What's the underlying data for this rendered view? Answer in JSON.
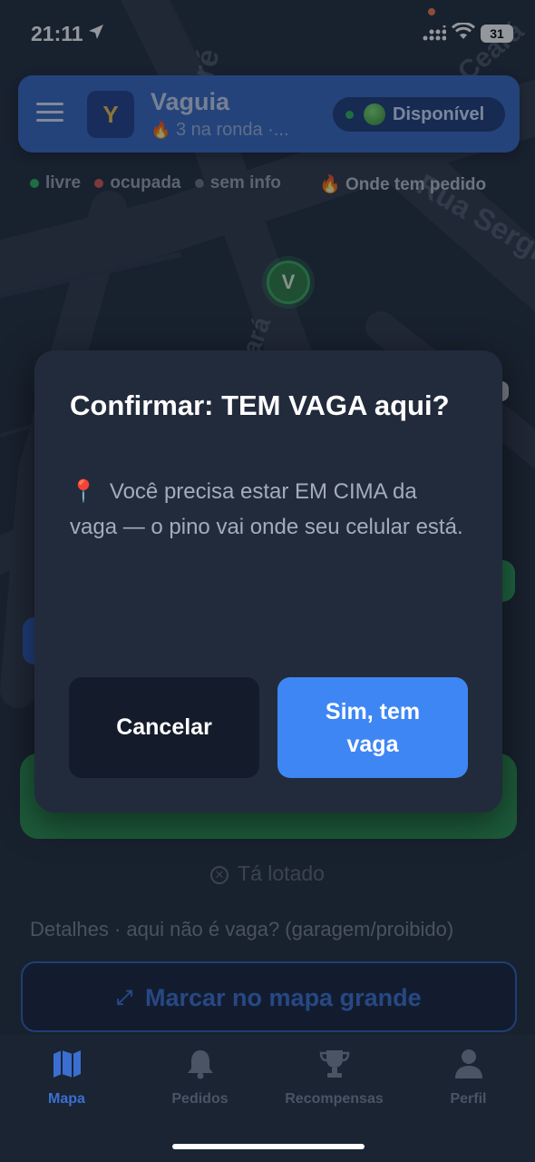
{
  "status_bar": {
    "time": "21:11",
    "battery": "31"
  },
  "map": {
    "street_labels": [
      "aré",
      "Rua Sergipe",
      "Ceará",
      "ará"
    ],
    "marker_v_label": "V"
  },
  "header": {
    "logo_letter": "Y",
    "title": "Vaguia",
    "subtitle_icon": "🔥",
    "subtitle": "3 na ronda ·...",
    "status_label": "Disponível",
    "status_color": "#2bb25d"
  },
  "legend": {
    "items": [
      {
        "label": "livre",
        "color": "#2bb25d"
      },
      {
        "label": "ocupada",
        "color": "#d9534f"
      },
      {
        "label": "sem info",
        "color": "#6b7486"
      }
    ],
    "orders_icon": "🔥",
    "orders_label": "Onde tem pedido"
  },
  "modal": {
    "title": "Confirmar: TEM VAGA aqui?",
    "body_icon": "📍",
    "body": "Você precisa estar EM CIMA da vaga — o pino vai onde seu celular está.",
    "cancel_label": "Cancelar",
    "confirm_label": "Sim, tem vaga",
    "confirm_color": "#3f86f5"
  },
  "behind": {
    "lotado_label": "Tá lotado",
    "details_text": "Detalhes · aqui não é vaga? (garagem/proibido)",
    "big_map_button": "Marcar no mapa grande"
  },
  "tabs": [
    {
      "label": "Mapa",
      "icon": "map-icon",
      "active": true
    },
    {
      "label": "Pedidos",
      "icon": "bell-icon",
      "active": false
    },
    {
      "label": "Recompensas",
      "icon": "trophy-icon",
      "active": false
    },
    {
      "label": "Perfil",
      "icon": "person-icon",
      "active": false
    }
  ]
}
